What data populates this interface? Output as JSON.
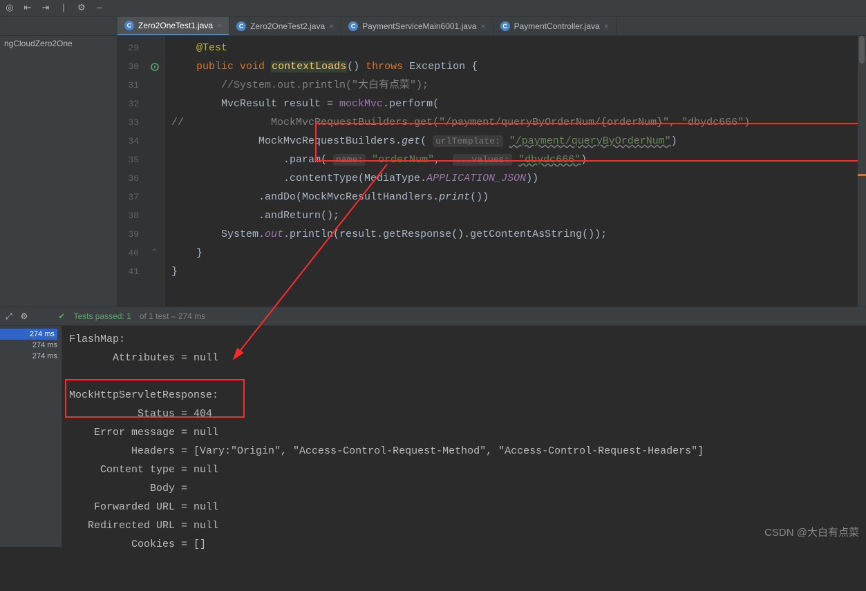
{
  "projectTree": {
    "root": "ngCloudZero2One"
  },
  "tabs": [
    {
      "label": "Zero2OneTest1.java",
      "active": true
    },
    {
      "label": "Zero2OneTest2.java",
      "active": false
    },
    {
      "label": "PaymentServiceMain6001.java",
      "active": false
    },
    {
      "label": "PaymentController.java",
      "active": false
    }
  ],
  "code": {
    "startLine": 29,
    "l29": "@Test",
    "l30_kw1": "public",
    "l30_kw2": "void",
    "l30_fn": "contextLoads",
    "l30_sig": "()",
    "l30_kw3": "throws",
    "l30_exc": "Exception",
    "l30_brace": " {",
    "l31": "//System.out.println(\"大白有点菜\");",
    "l32_a": "MvcResult result = ",
    "l32_b": "mockMvc",
    "l32_c": ".perform(",
    "l33_a": "//",
    "l33_b": "MockMvcRequestBuilders.get(",
    "l33_c": "\"/payment/queryByOrderNum/{orderNum}\"",
    "l33_d": ", ",
    "l33_e": "\"dbydc666\"",
    "l33_f": ")",
    "l34_a": "MockMvcRequestBuilders.",
    "l34_fn": "get",
    "l34_p1": "urlTemplate:",
    "l34_s1": "\"/payment/queryByOrderNum\"",
    "l34_end": ")",
    "l35_a": ".param(",
    "l35_p1": "name:",
    "l35_s1": "\"orderNum\"",
    "l35_c": ",",
    "l35_p2": "...values:",
    "l35_s2": "\"dbydc666\"",
    "l35_end": ")",
    "l36_a": ".contentType(MediaType.",
    "l36_b": "APPLICATION_JSON",
    "l36_c": "))",
    "l37_a": ".andDo(MockMvcResultHandlers.",
    "l37_b": "print",
    "l37_c": "())",
    "l38": ".andReturn();",
    "l39_a": "System.",
    "l39_b": "out",
    "l39_c": ".println(result.getResponse().getContentAsString());",
    "l40": "}",
    "l41": "}"
  },
  "testStatus": {
    "passLabel": "Tests passed: 1",
    "suffix": " of 1 test – 274 ms"
  },
  "testTree": {
    "t1": "274 ms",
    "t2": "274 ms",
    "t3": "274 ms"
  },
  "console": {
    "l1": "FlashMap:",
    "l2": "       Attributes = null",
    "l3": "",
    "l4": "MockHttpServletResponse:",
    "l5": "           Status = 404",
    "l6": "    Error message = null",
    "l7": "          Headers = [Vary:\"Origin\", \"Access-Control-Request-Method\", \"Access-Control-Request-Headers\"]",
    "l8": "     Content type = null",
    "l9": "             Body = ",
    "l10": "    Forwarded URL = null",
    "l11": "   Redirected URL = null",
    "l12": "          Cookies = []"
  },
  "watermark": "CSDN @大白有点菜"
}
